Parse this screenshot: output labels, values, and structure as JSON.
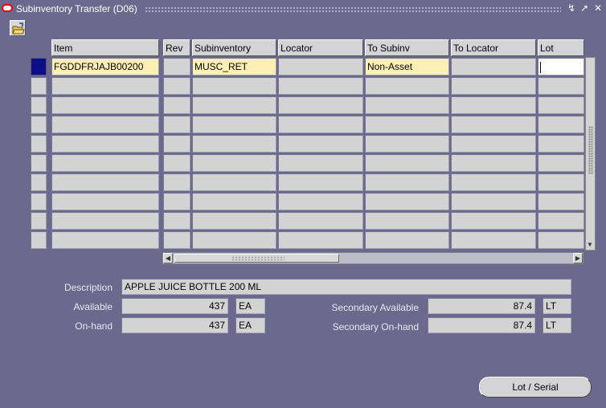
{
  "window": {
    "title": "Subinventory Transfer (D06)"
  },
  "columns": [
    "Item",
    "Rev",
    "Subinventory",
    "Locator",
    "To Subinv",
    "To Locator",
    "Lot"
  ],
  "rows": [
    [
      "FGDDFRJAJB00200",
      "",
      "MUSC_RET",
      "",
      "Non-Asset",
      "",
      ""
    ],
    [
      "",
      "",
      "",
      "",
      "",
      "",
      ""
    ],
    [
      "",
      "",
      "",
      "",
      "",
      "",
      ""
    ],
    [
      "",
      "",
      "",
      "",
      "",
      "",
      ""
    ],
    [
      "",
      "",
      "",
      "",
      "",
      "",
      ""
    ],
    [
      "",
      "",
      "",
      "",
      "",
      "",
      ""
    ],
    [
      "",
      "",
      "",
      "",
      "",
      "",
      ""
    ],
    [
      "",
      "",
      "",
      "",
      "",
      "",
      ""
    ],
    [
      "",
      "",
      "",
      "",
      "",
      "",
      ""
    ],
    [
      "",
      "",
      "",
      "",
      "",
      "",
      ""
    ]
  ],
  "details": {
    "description_label": "Description",
    "description": "APPLE JUICE BOTTLE  200 ML",
    "available_label": "Available",
    "available": "437",
    "available_uom": "EA",
    "onhand_label": "On-hand",
    "onhand": "437",
    "onhand_uom": "EA",
    "sec_available_label": "Secondary Available",
    "sec_available": "87.4",
    "sec_available_uom": "LT",
    "sec_onhand_label": "Secondary On-hand",
    "sec_onhand": "87.4",
    "sec_onhand_uom": "LT"
  },
  "buttons": {
    "lot_serial": "Lot / Serial"
  },
  "colors": {
    "background": "#6b6a8e",
    "required_field": "#fdf0b6",
    "current_row": "#0a0f86"
  },
  "icons": [
    "oracle-logo-icon",
    "minimize-icon",
    "maximize-icon",
    "close-icon",
    "open-folder-icon"
  ]
}
